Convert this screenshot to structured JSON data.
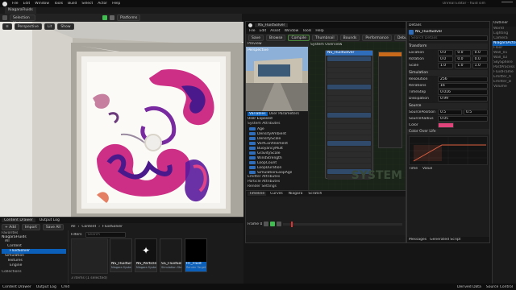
{
  "top_menu": {
    "items": [
      "File",
      "Edit",
      "Window",
      "Tools",
      "Build",
      "Select",
      "Actor",
      "Help"
    ],
    "project_tab": "NiagaraFluids",
    "window_title": "Unreal Editor - fluid sim"
  },
  "toolbar": {
    "mode_label": "Selection Mode",
    "platforms_label": "Platforms"
  },
  "viewport": {
    "label": "Perspective",
    "lit_label": "Lit",
    "show_label": "Show"
  },
  "bottom_left": {
    "tabs": [
      "Content Drawer",
      "Output Log"
    ],
    "toolbar": {
      "add_label": "+ Add",
      "import_label": "Import",
      "save_label": "Save All"
    },
    "path": [
      "All",
      "Content",
      "FluidSolver"
    ],
    "search_placeholder": "Search",
    "tree_header": "Favorites",
    "tree_root": "NiagaraFluids",
    "tree_items": [
      "All",
      "Content",
      "FluidSolver",
      "Simulation",
      "Textures",
      "Engine"
    ],
    "collections_label": "Collections",
    "filters_label": "Filters",
    "assets": [
      {
        "name": "NS_FluidSim",
        "type": "Niagara System"
      },
      {
        "name": "NS_Particles",
        "type": "Niagara System"
      },
      {
        "name": "SS_FluidSolver",
        "type": "Simulation Stage"
      },
      {
        "name": "RT_Fluid",
        "type": "Render Target"
      }
    ],
    "status": "3 items (1 selected)"
  },
  "niagara": {
    "title": "NS_FluidSolver",
    "menus": [
      "File",
      "Edit",
      "Asset",
      "Window",
      "Tools",
      "Help"
    ],
    "toolbar": {
      "save": "Save",
      "browse": "Browse",
      "compile": "Compile",
      "thumbnail": "Thumbnail",
      "bounds": "Bounds",
      "performance": "Performance",
      "debug": "Debug",
      "simulation": "Simulation",
      "baker": "Baker",
      "scalability": "Scalability"
    },
    "preview_tabs": [
      "Preview",
      "Parameters"
    ],
    "preview_label": "Perspective",
    "system_overview_label": "System Overview",
    "graph_title": "NS_FluidSolver",
    "graph_watermark": "SYSTEM",
    "params_tabs": [
      "Variables",
      "User Parameters"
    ],
    "params_header": "User Exposed",
    "system_attrs": "System Attributes",
    "params": [
      "Age",
      "DensityAmbient",
      "DensityScale",
      "VortConfinement",
      "BuoyancyMult",
      "GravityScale",
      "WindStrength",
      "LoopCount",
      "LoopDuration",
      "SimulationLoopAge"
    ],
    "emitter_attrs": "Emitter Attributes",
    "particle_attrs": "Particle Attributes",
    "render_label": "Render Settings",
    "timeline_tabs": [
      "Timeline",
      "Curves",
      "Niagara",
      "Scratch"
    ],
    "timeline_frame": "Frame 0",
    "stats_label": "System Overview"
  },
  "details": {
    "title": "Details",
    "selected": "NS_FluidSolver",
    "component": "FluidSolver",
    "search_placeholder": "Search Details",
    "sections": [
      {
        "label": "Transform",
        "rows": [
          {
            "name": "Location",
            "vals": [
              "0.0",
              "0.0",
              "0.0"
            ]
          },
          {
            "name": "Rotation",
            "vals": [
              "0.0",
              "0.0",
              "0.0"
            ]
          },
          {
            "name": "Scale",
            "vals": [
              "1.0",
              "1.0",
              "1.0"
            ]
          }
        ]
      },
      {
        "label": "Simulation",
        "rows": [
          {
            "name": "Resolution",
            "vals": [
              "256"
            ]
          },
          {
            "name": "Iterations",
            "vals": [
              "16"
            ]
          },
          {
            "name": "TimeStep",
            "vals": [
              "0.016"
            ]
          },
          {
            "name": "Dissipation",
            "vals": [
              "0.99"
            ]
          }
        ]
      },
      {
        "label": "Source",
        "rows": [
          {
            "name": "SourcePosition",
            "vals": [
              "0.5",
              "0.5"
            ]
          },
          {
            "name": "SourceRadius",
            "vals": [
              "0.05"
            ]
          },
          {
            "name": "Color",
            "vals": [
              "#E0447A"
            ]
          }
        ]
      }
    ],
    "curve_section": "Color Over Life",
    "curve_labels": [
      "Time",
      "Value"
    ],
    "bottom_tabs": [
      "Messages",
      "Generated Script"
    ]
  },
  "outliner": {
    "title": "Outliner",
    "items": [
      "World",
      "Lighting",
      "Camera",
      "NiagaraActor",
      "Floor",
      "Wall_01",
      "Wall_02",
      "SkySphere",
      "PostProcess",
      "FluidFrame",
      "Emitter_A",
      "Emitter_B",
      "Volume"
    ]
  },
  "statusbar": {
    "left": [
      "Content Drawer",
      "Output Log",
      "Cmd"
    ],
    "right": [
      "Derived Data",
      "Source Control"
    ]
  },
  "colors": {
    "accent": "#0070e0",
    "fluid_magenta": "#c8187a",
    "fluid_purple": "#4a1a8c",
    "fluid_orange": "#e06040",
    "panel": "#1e1e1e",
    "graph_bg": "#1a2418"
  }
}
